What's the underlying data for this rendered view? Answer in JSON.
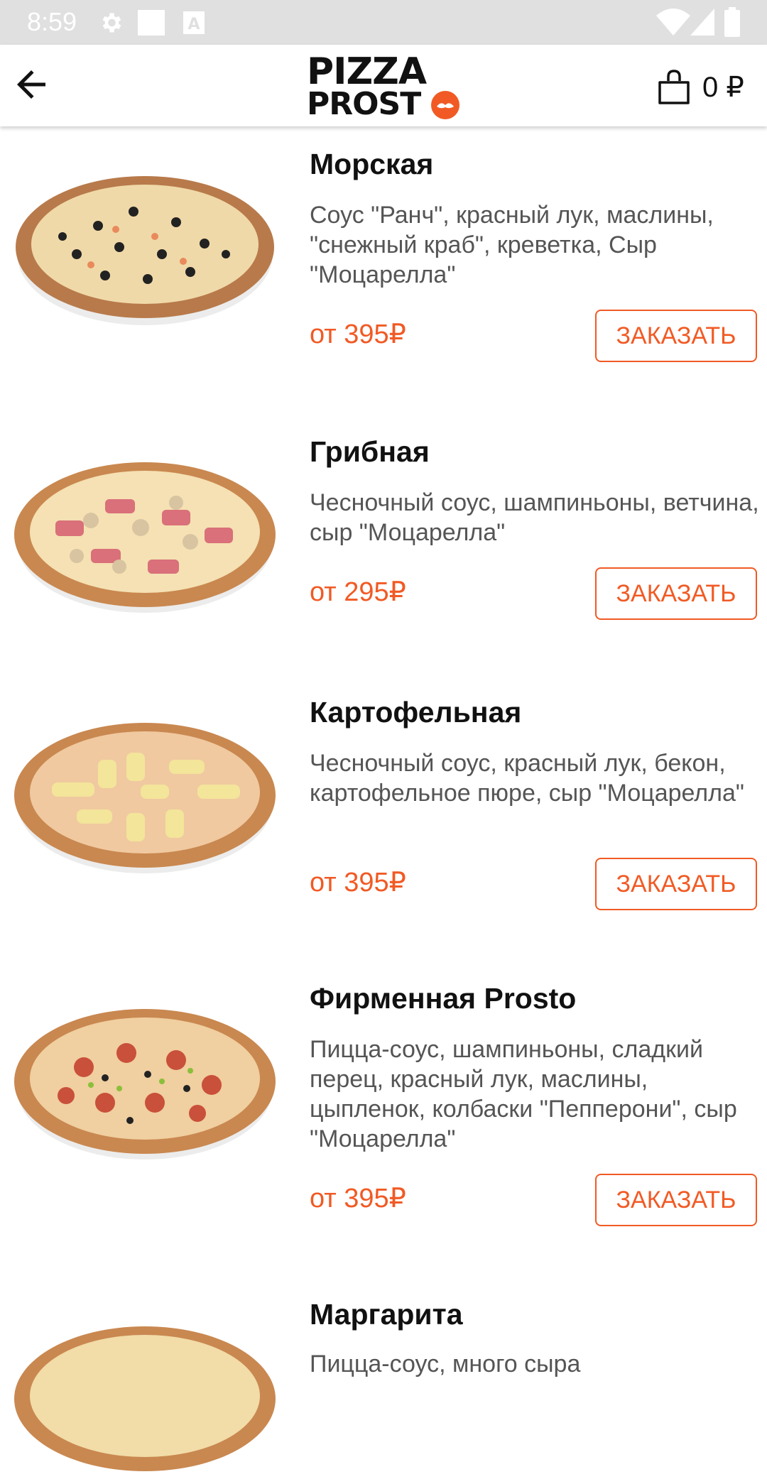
{
  "status_bar": {
    "time": "8:59"
  },
  "header": {
    "logo_line1": "PIZZA",
    "logo_line2": "PROST",
    "cart_total": "0 ₽"
  },
  "colors": {
    "accent": "#f15a24",
    "status_bar": "#e0e0e0"
  },
  "items": [
    {
      "title": "Морская",
      "desc": "Соус \"Ранч\", красный лук, маслины, \"снежный краб\", креветка, Сыр \"Моцарелла\"",
      "price": "от 395₽",
      "button": "ЗАКАЗАТЬ"
    },
    {
      "title": "Грибная",
      "desc": "Чесночный соус, шампиньоны, ветчина, сыр \"Моцарелла\"",
      "price": "от 295₽",
      "button": "ЗАКАЗАТЬ"
    },
    {
      "title": "Картофельная",
      "desc": "Чесночный соус, красный лук, бекон, картофельное пюре, сыр \"Моцарелла\"",
      "price": "от 395₽",
      "button": "ЗАКАЗАТЬ"
    },
    {
      "title": "Фирменная Prosto",
      "desc": "Пицца-соус, шампиньоны, сладкий перец, красный лук, маслины, цыпленок, колбаски \"Пепперони\", сыр \"Моцарелла\"",
      "price": "от 395₽",
      "button": "ЗАКАЗАТЬ"
    },
    {
      "title": "Маргарита",
      "desc": "Пицца-соус, много сыра",
      "price": "",
      "button": ""
    }
  ]
}
